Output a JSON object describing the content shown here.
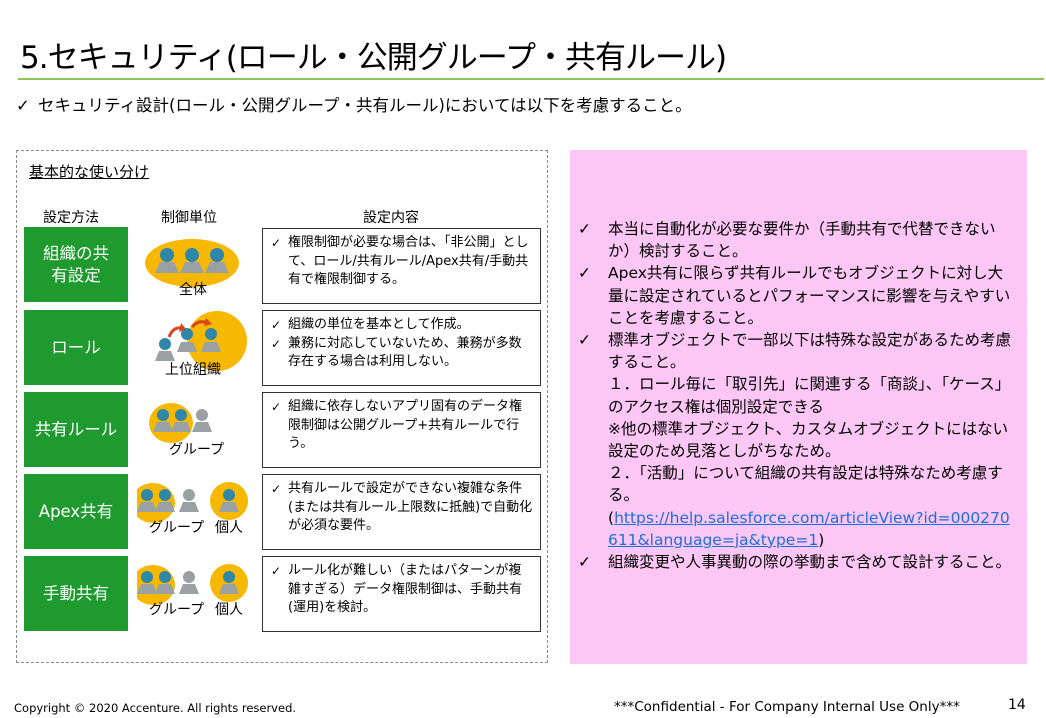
{
  "header": {
    "title": "5.セキュリティ(ロール・公開グループ・共有ルール)",
    "intro": "セキュリティ設計(ロール・公開グループ・共有ルール)においては以下を考慮すること。"
  },
  "left_panel": {
    "title": "基本的な使い分け",
    "headers": {
      "method": "設定方法",
      "unit": "制御単位",
      "content": "設定内容"
    },
    "rows": [
      {
        "method": "組織の共\n有設定",
        "unit_labels": [
          "全体"
        ],
        "icon": "org-wide-group-icon",
        "content": [
          "権限制御が必要な場合は、「非公開」として、ロール/共有ルール/Apex共有/手動共有で権限制御する。"
        ]
      },
      {
        "method": "ロール",
        "unit_labels": [
          "上位組織"
        ],
        "icon": "role-hierarchy-icon",
        "content": [
          "組織の単位を基本として作成。",
          "兼務に対応していないため、兼務が多数存在する場合は利用しない。"
        ]
      },
      {
        "method": "共有ルール",
        "unit_labels": [
          "グループ"
        ],
        "icon": "group-icon",
        "content": [
          "組織に依存しないアプリ固有のデータ権限制御は公開グループ+共有ルールで行う。"
        ]
      },
      {
        "method": "Apex共有",
        "unit_labels": [
          "グループ",
          "個人"
        ],
        "icon": "group-and-person-icon",
        "content": [
          "共有ルールで設定ができない複雑な条件(または共有ルール上限数に抵触)で自動化が必須な要件。"
        ]
      },
      {
        "method": "手動共有",
        "unit_labels": [
          "グループ",
          "個人"
        ],
        "icon": "group-and-person-icon",
        "content": [
          "ルール化が難しい（またはパターンが複雑すぎる）データ権限制御は、手動共有(運用)を検討。"
        ]
      }
    ]
  },
  "right_panel": {
    "notes": [
      {
        "text": "本当に自動化が必要な要件か（手動共有で代替できないか）検討すること。"
      },
      {
        "text": "Apex共有に限らず共有ルールでもオブジェクトに対し大量に設定されているとパフォーマンスに影響を与えやすいことを考慮すること。"
      },
      {
        "text": "標準オブジェクトで一部以下は特殊な設定があるため考慮すること。",
        "sub": [
          "１．ロール毎に「取引先」に関連する「商談」、「ケース」のアクセス権は個別設定できる",
          "※他の標準オブジェクト、カスタムオブジェクトにはない設定のため見落としがちなため。",
          "２．「活動」について組織の共有設定は特殊なため考慮する。"
        ],
        "link_prefix": "(",
        "link": "https://help.salesforce.com/articleView?id=000270611&language=ja&type=1",
        "link_suffix": ")"
      },
      {
        "text": "組織変更や人事異動の際の挙動まで含めて設計すること。"
      }
    ]
  },
  "footer": {
    "copyright": "Copyright © 2020 Accenture. All rights reserved.",
    "confidential": "***Confidential - For Company Internal Use Only***",
    "page": "14"
  },
  "colors": {
    "green": "#1e9a2f",
    "pink": "#fcc7f5",
    "accent": "#8fc45a",
    "link": "#1e6fd9",
    "person": "#2e86a8",
    "circle": "#f6b800"
  }
}
